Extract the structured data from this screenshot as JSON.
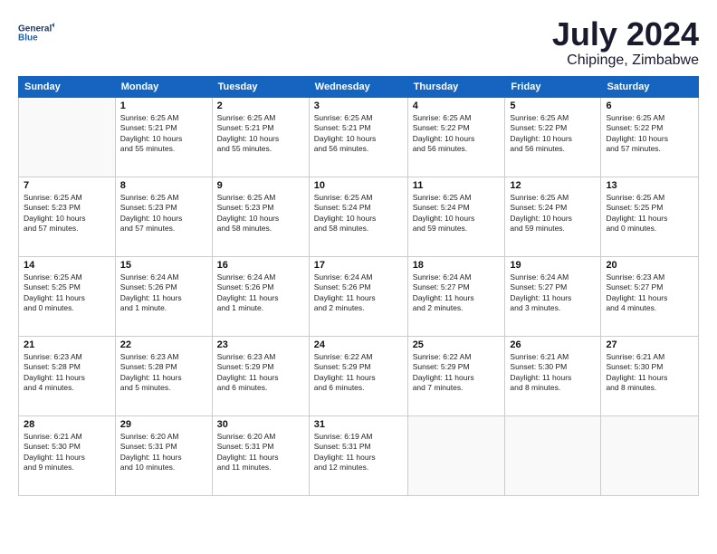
{
  "logo": {
    "line1": "General",
    "line2": "Blue"
  },
  "title": "July 2024",
  "location": "Chipinge, Zimbabwe",
  "days_of_week": [
    "Sunday",
    "Monday",
    "Tuesday",
    "Wednesday",
    "Thursday",
    "Friday",
    "Saturday"
  ],
  "weeks": [
    [
      {
        "num": "",
        "info": ""
      },
      {
        "num": "1",
        "info": "Sunrise: 6:25 AM\nSunset: 5:21 PM\nDaylight: 10 hours\nand 55 minutes."
      },
      {
        "num": "2",
        "info": "Sunrise: 6:25 AM\nSunset: 5:21 PM\nDaylight: 10 hours\nand 55 minutes."
      },
      {
        "num": "3",
        "info": "Sunrise: 6:25 AM\nSunset: 5:21 PM\nDaylight: 10 hours\nand 56 minutes."
      },
      {
        "num": "4",
        "info": "Sunrise: 6:25 AM\nSunset: 5:22 PM\nDaylight: 10 hours\nand 56 minutes."
      },
      {
        "num": "5",
        "info": "Sunrise: 6:25 AM\nSunset: 5:22 PM\nDaylight: 10 hours\nand 56 minutes."
      },
      {
        "num": "6",
        "info": "Sunrise: 6:25 AM\nSunset: 5:22 PM\nDaylight: 10 hours\nand 57 minutes."
      }
    ],
    [
      {
        "num": "7",
        "info": "Sunrise: 6:25 AM\nSunset: 5:23 PM\nDaylight: 10 hours\nand 57 minutes."
      },
      {
        "num": "8",
        "info": "Sunrise: 6:25 AM\nSunset: 5:23 PM\nDaylight: 10 hours\nand 57 minutes."
      },
      {
        "num": "9",
        "info": "Sunrise: 6:25 AM\nSunset: 5:23 PM\nDaylight: 10 hours\nand 58 minutes."
      },
      {
        "num": "10",
        "info": "Sunrise: 6:25 AM\nSunset: 5:24 PM\nDaylight: 10 hours\nand 58 minutes."
      },
      {
        "num": "11",
        "info": "Sunrise: 6:25 AM\nSunset: 5:24 PM\nDaylight: 10 hours\nand 59 minutes."
      },
      {
        "num": "12",
        "info": "Sunrise: 6:25 AM\nSunset: 5:24 PM\nDaylight: 10 hours\nand 59 minutes."
      },
      {
        "num": "13",
        "info": "Sunrise: 6:25 AM\nSunset: 5:25 PM\nDaylight: 11 hours\nand 0 minutes."
      }
    ],
    [
      {
        "num": "14",
        "info": "Sunrise: 6:25 AM\nSunset: 5:25 PM\nDaylight: 11 hours\nand 0 minutes."
      },
      {
        "num": "15",
        "info": "Sunrise: 6:24 AM\nSunset: 5:26 PM\nDaylight: 11 hours\nand 1 minute."
      },
      {
        "num": "16",
        "info": "Sunrise: 6:24 AM\nSunset: 5:26 PM\nDaylight: 11 hours\nand 1 minute."
      },
      {
        "num": "17",
        "info": "Sunrise: 6:24 AM\nSunset: 5:26 PM\nDaylight: 11 hours\nand 2 minutes."
      },
      {
        "num": "18",
        "info": "Sunrise: 6:24 AM\nSunset: 5:27 PM\nDaylight: 11 hours\nand 2 minutes."
      },
      {
        "num": "19",
        "info": "Sunrise: 6:24 AM\nSunset: 5:27 PM\nDaylight: 11 hours\nand 3 minutes."
      },
      {
        "num": "20",
        "info": "Sunrise: 6:23 AM\nSunset: 5:27 PM\nDaylight: 11 hours\nand 4 minutes."
      }
    ],
    [
      {
        "num": "21",
        "info": "Sunrise: 6:23 AM\nSunset: 5:28 PM\nDaylight: 11 hours\nand 4 minutes."
      },
      {
        "num": "22",
        "info": "Sunrise: 6:23 AM\nSunset: 5:28 PM\nDaylight: 11 hours\nand 5 minutes."
      },
      {
        "num": "23",
        "info": "Sunrise: 6:23 AM\nSunset: 5:29 PM\nDaylight: 11 hours\nand 6 minutes."
      },
      {
        "num": "24",
        "info": "Sunrise: 6:22 AM\nSunset: 5:29 PM\nDaylight: 11 hours\nand 6 minutes."
      },
      {
        "num": "25",
        "info": "Sunrise: 6:22 AM\nSunset: 5:29 PM\nDaylight: 11 hours\nand 7 minutes."
      },
      {
        "num": "26",
        "info": "Sunrise: 6:21 AM\nSunset: 5:30 PM\nDaylight: 11 hours\nand 8 minutes."
      },
      {
        "num": "27",
        "info": "Sunrise: 6:21 AM\nSunset: 5:30 PM\nDaylight: 11 hours\nand 8 minutes."
      }
    ],
    [
      {
        "num": "28",
        "info": "Sunrise: 6:21 AM\nSunset: 5:30 PM\nDaylight: 11 hours\nand 9 minutes."
      },
      {
        "num": "29",
        "info": "Sunrise: 6:20 AM\nSunset: 5:31 PM\nDaylight: 11 hours\nand 10 minutes."
      },
      {
        "num": "30",
        "info": "Sunrise: 6:20 AM\nSunset: 5:31 PM\nDaylight: 11 hours\nand 11 minutes."
      },
      {
        "num": "31",
        "info": "Sunrise: 6:19 AM\nSunset: 5:31 PM\nDaylight: 11 hours\nand 12 minutes."
      },
      {
        "num": "",
        "info": ""
      },
      {
        "num": "",
        "info": ""
      },
      {
        "num": "",
        "info": ""
      }
    ]
  ]
}
